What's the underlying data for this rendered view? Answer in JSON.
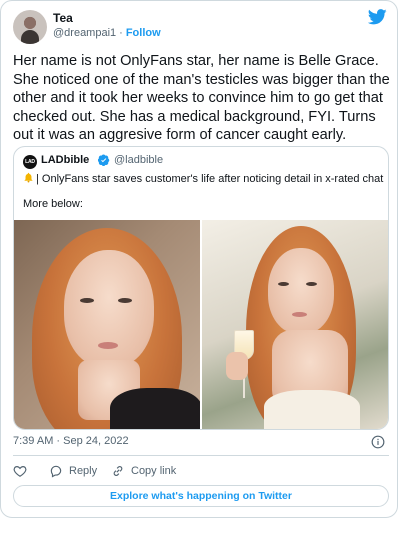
{
  "author": {
    "name": "Tea",
    "handle": "@dreampai1",
    "separator": "·",
    "follow_label": "Follow"
  },
  "tweet": {
    "text": "Her name is not OnlyFans star, her name is Belle Grace. She noticed one of the man's testicles was bigger than the other and it took her weeks to convince him to go get that checked out. She has a medical background, FYI. Turns out it was an aggresive form of cancer caught early."
  },
  "quoted": {
    "logo_text": "LAD",
    "name": "LADbible",
    "handle": "@ladbible",
    "line1": "| OnlyFans star saves customer's life after noticing detail in x-rated chat",
    "line2": "More below:",
    "icons": [
      "bell-icon",
      "verified-badge-icon"
    ]
  },
  "footer": {
    "timestamp": "7:39 AM · Sep 24, 2022",
    "reply_label": "Reply",
    "copy_label": "Copy link",
    "explore_label": "Explore what's happening on Twitter"
  },
  "colors": {
    "accent": "#1d9bf0",
    "text": "#0f1419",
    "secondary": "#536471",
    "border": "#cfd9de"
  }
}
